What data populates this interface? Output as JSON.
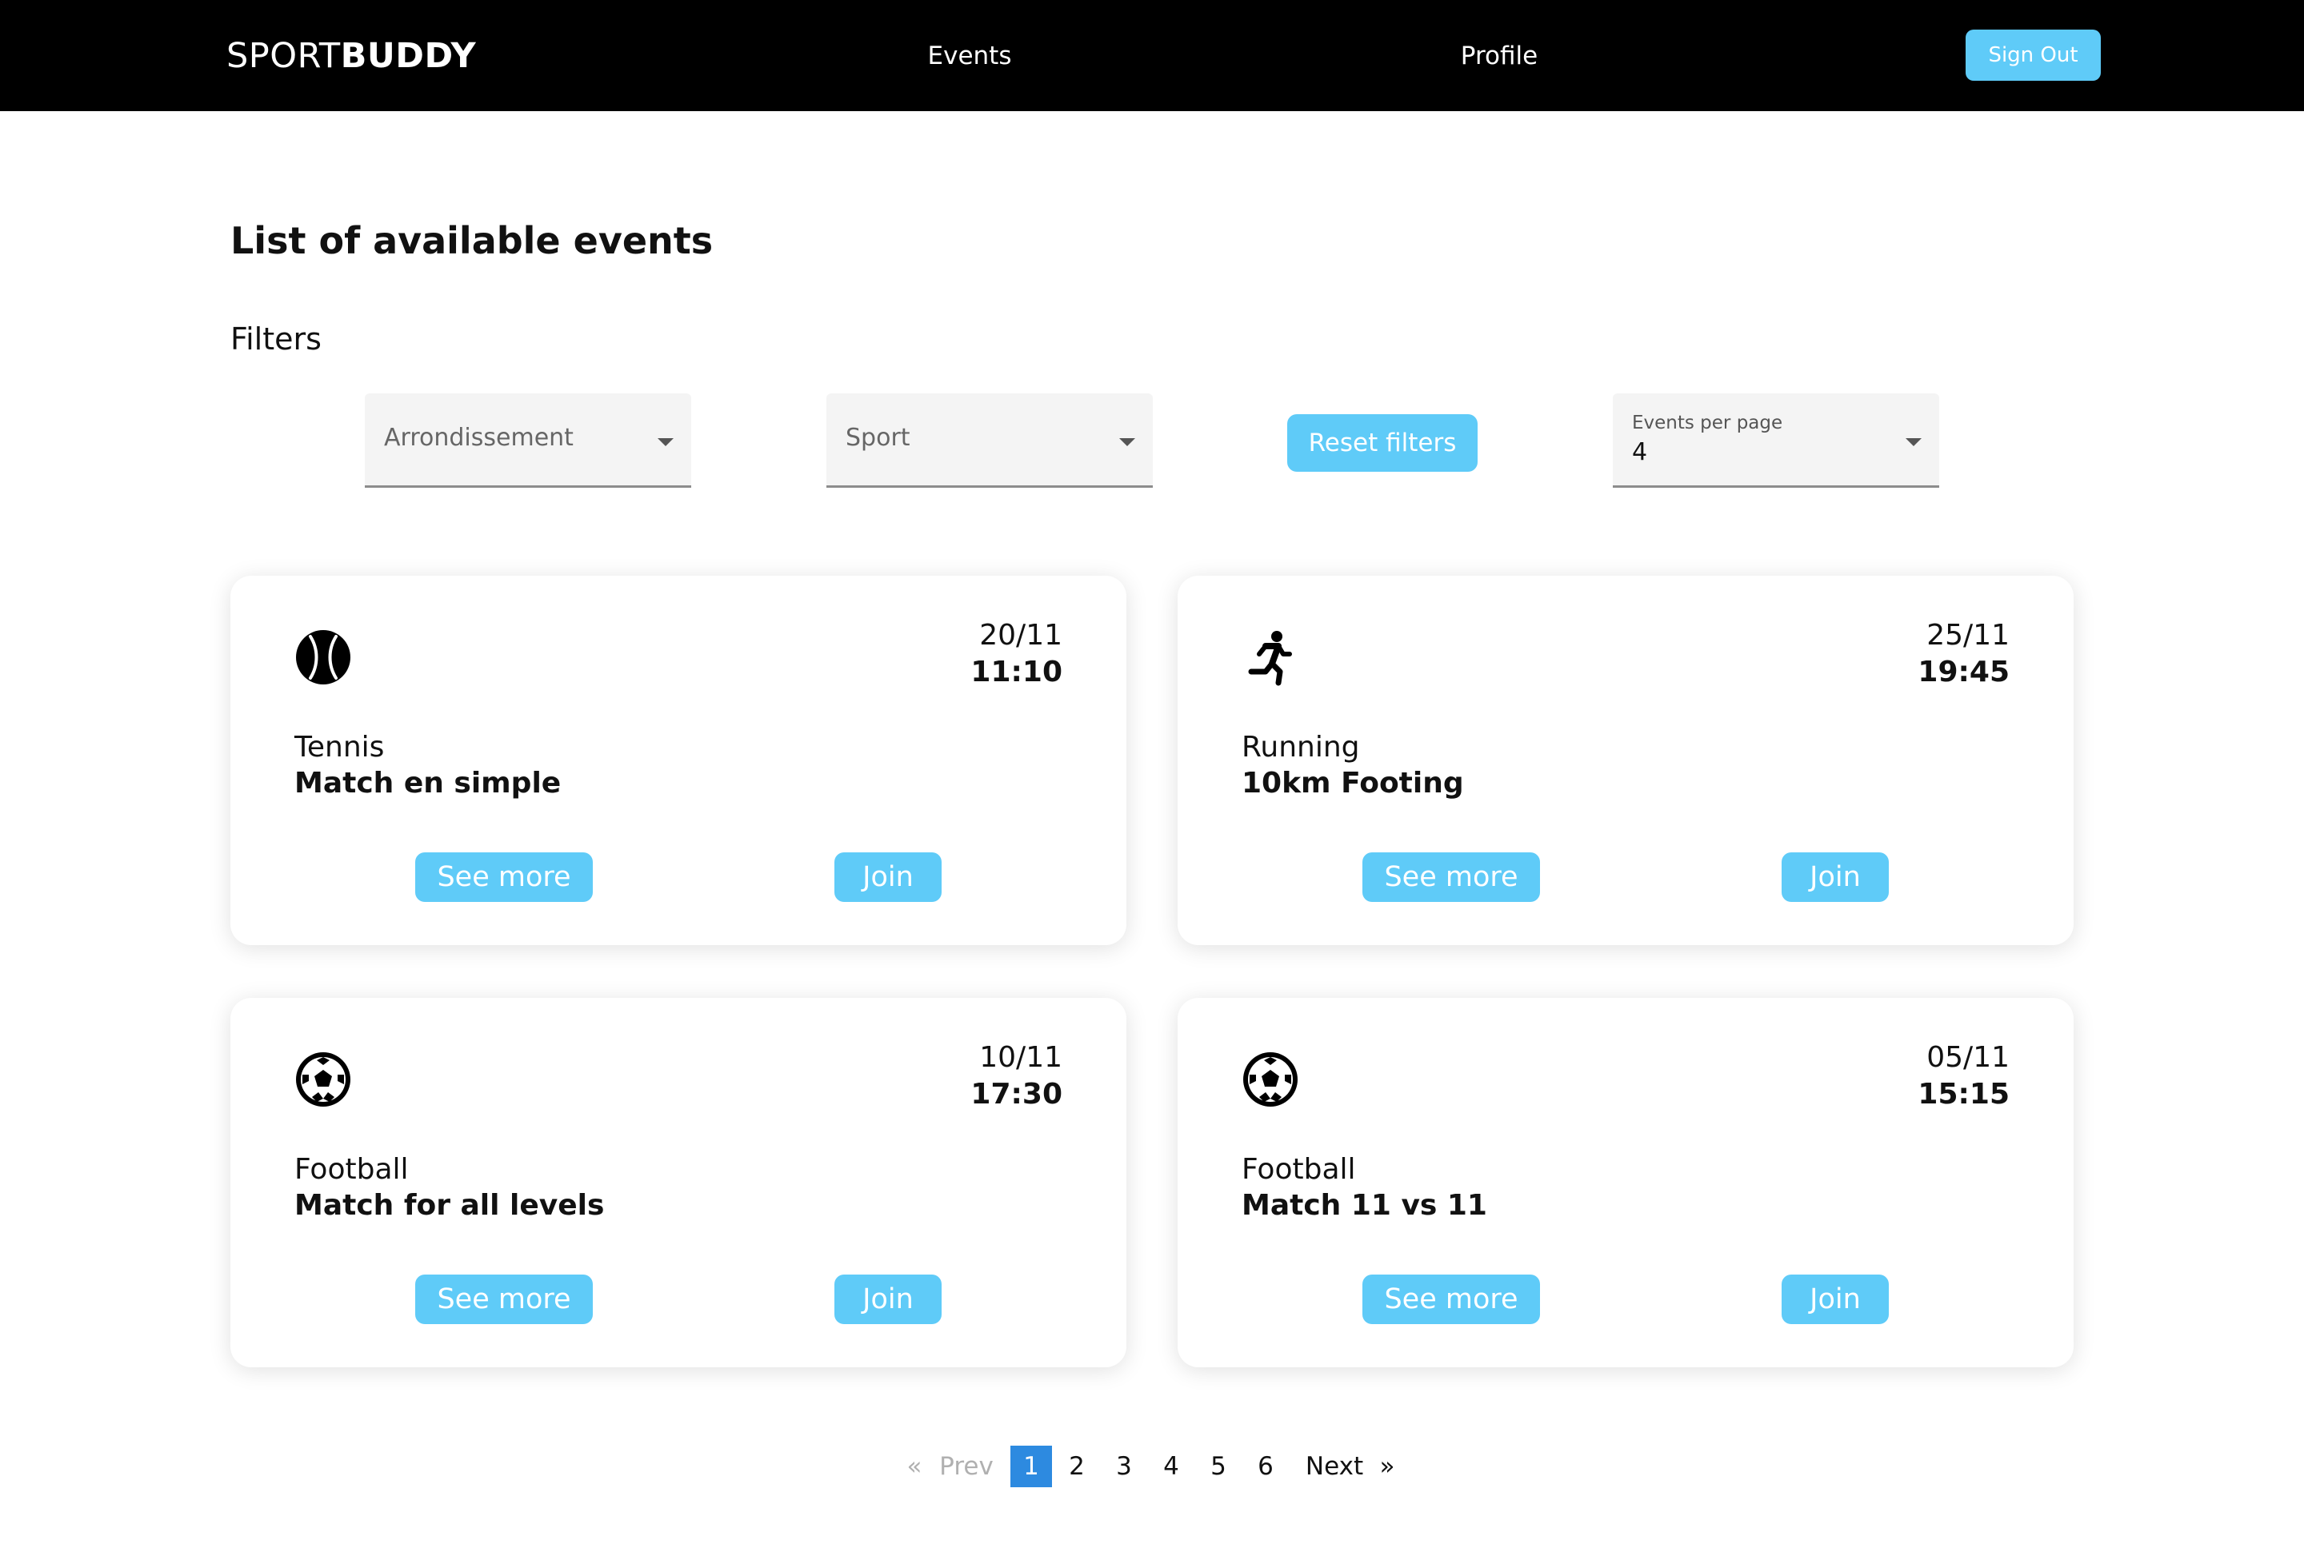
{
  "header": {
    "logo_light": "SPORT",
    "logo_bold": "BUDDY",
    "nav": {
      "events": "Events",
      "profile": "Profile"
    },
    "sign_out": "Sign Out"
  },
  "main": {
    "title": "List of available events",
    "filters_label": "Filters"
  },
  "filters": {
    "arrondissement": {
      "placeholder": "Arrondissement",
      "icon": "chevron-down-icon"
    },
    "sport": {
      "placeholder": "Sport",
      "icon": "chevron-down-icon"
    },
    "reset": "Reset filters",
    "per_page": {
      "label": "Events per page",
      "value": "4",
      "icon": "chevron-down-icon"
    }
  },
  "events": [
    {
      "icon": "tennis-ball-icon",
      "date": "20/11",
      "time": "11:10",
      "sport": "Tennis",
      "title": "Match en simple",
      "see_more": "See more",
      "join": "Join"
    },
    {
      "icon": "running-person-icon",
      "date": "25/11",
      "time": "19:45",
      "sport": "Running",
      "title": "10km Footing",
      "see_more": "See more",
      "join": "Join"
    },
    {
      "icon": "soccer-ball-icon",
      "date": "10/11",
      "time": "17:30",
      "sport": "Football",
      "title": "Match for all levels",
      "see_more": "See more",
      "join": "Join"
    },
    {
      "icon": "soccer-ball-icon",
      "date": "05/11",
      "time": "15:15",
      "sport": "Football",
      "title": "Match 11 vs 11",
      "see_more": "See more",
      "join": "Join"
    }
  ],
  "pagination": {
    "first": "«",
    "prev": "Prev",
    "pages": [
      "1",
      "2",
      "3",
      "4",
      "5",
      "6"
    ],
    "current": "1",
    "next": "Next",
    "last": "»"
  },
  "colors": {
    "accent": "#5fcbf8",
    "active_page": "#2d8ae0",
    "header_bg": "#000000"
  }
}
